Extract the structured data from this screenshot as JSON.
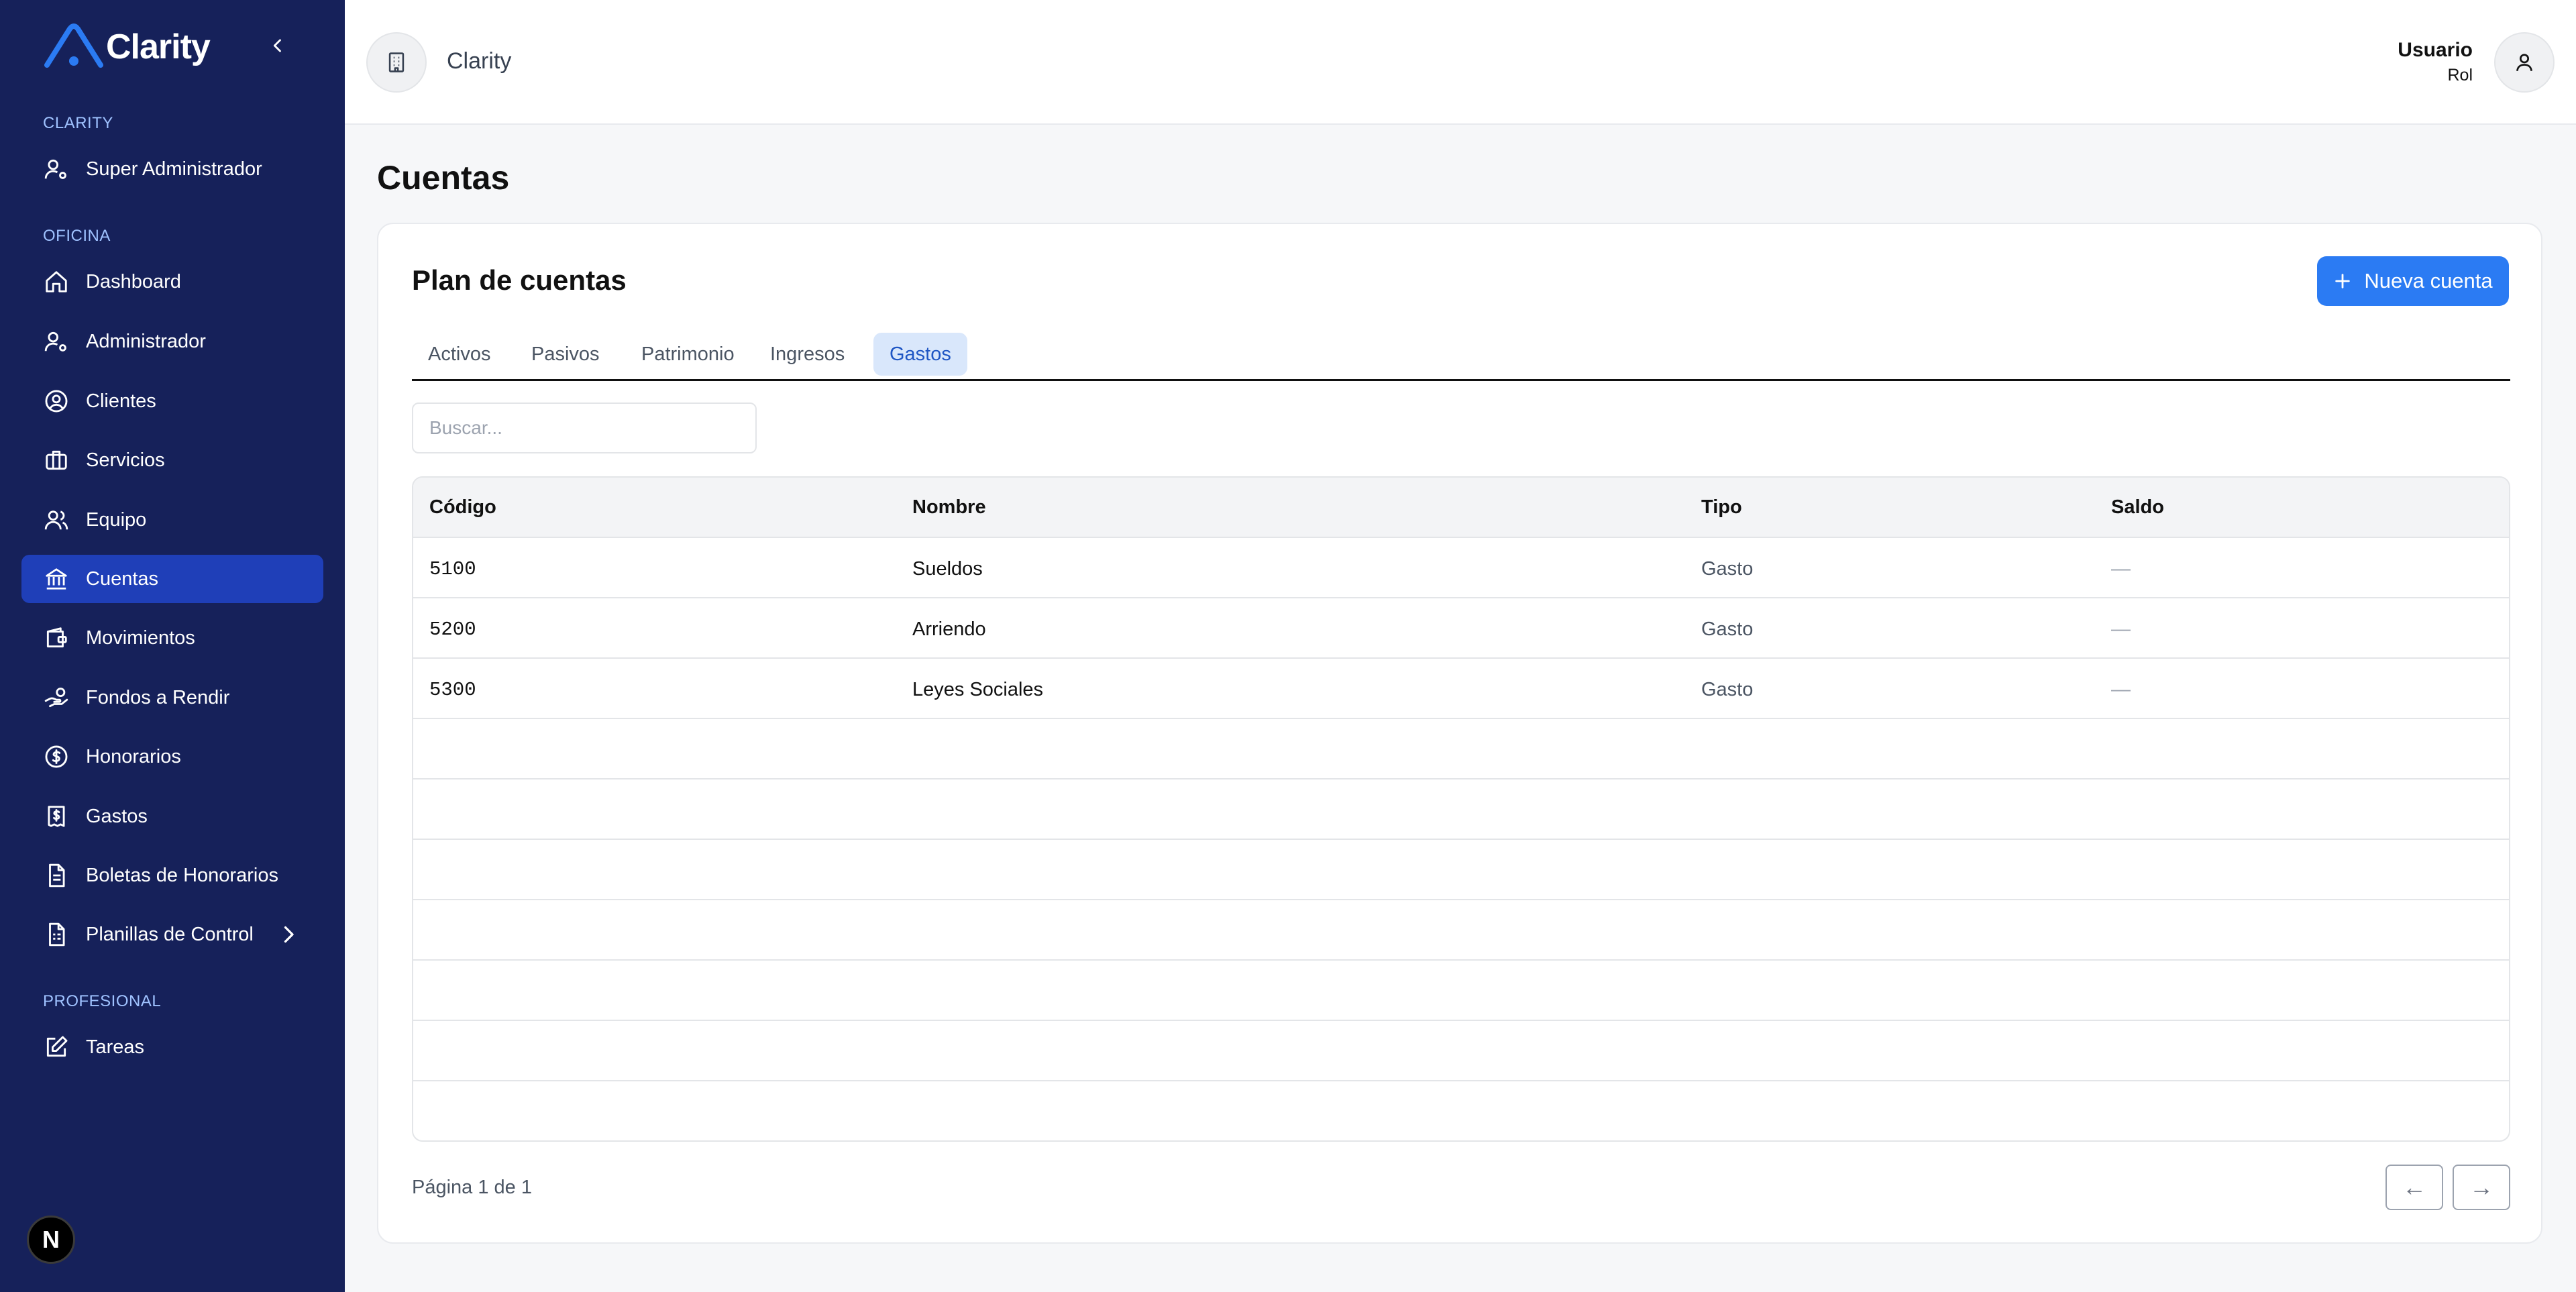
{
  "brand": {
    "name": "Clarity",
    "accent": "#2b7bf3"
  },
  "sidebar": {
    "sections": [
      {
        "label": "CLARITY",
        "items": [
          {
            "label": "Super Administrador",
            "icon": "user-gear-icon"
          }
        ]
      },
      {
        "label": "OFICINA",
        "items": [
          {
            "label": "Dashboard",
            "icon": "home-icon"
          },
          {
            "label": "Administrador",
            "icon": "user-gear-icon"
          },
          {
            "label": "Clientes",
            "icon": "user-circle-icon"
          },
          {
            "label": "Servicios",
            "icon": "briefcase-icon"
          },
          {
            "label": "Equipo",
            "icon": "users-icon"
          },
          {
            "label": "Cuentas",
            "icon": "bank-icon",
            "active": true
          },
          {
            "label": "Movimientos",
            "icon": "wallet-icon"
          },
          {
            "label": "Fondos a Rendir",
            "icon": "hand-coins-icon"
          },
          {
            "label": "Honorarios",
            "icon": "dollar-circle-icon"
          },
          {
            "label": "Gastos",
            "icon": "receipt-dollar-icon"
          },
          {
            "label": "Boletas de Honorarios",
            "icon": "document-icon"
          },
          {
            "label": "Planillas de Control",
            "icon": "spreadsheet-icon"
          }
        ]
      },
      {
        "label": "PROFESIONAL",
        "items": [
          {
            "label": "Tareas",
            "icon": "pencil-square-icon"
          }
        ]
      }
    ],
    "badge": "N"
  },
  "header": {
    "org_name": "Clarity",
    "user_name": "Usuario",
    "user_role": "Rol"
  },
  "page": {
    "title": "Cuentas"
  },
  "card": {
    "title": "Plan de cuentas",
    "new_button": "Nueva cuenta",
    "tabs": [
      "Activos",
      "Pasivos",
      "Patrimonio",
      "Ingresos",
      "Gastos"
    ],
    "active_tab": "Gastos",
    "search_placeholder": "Buscar..."
  },
  "table": {
    "columns": [
      "Código",
      "Nombre",
      "Tipo",
      "Saldo"
    ],
    "rows": [
      {
        "codigo": "5100",
        "nombre": "Sueldos",
        "tipo": "Gasto",
        "saldo": "—"
      },
      {
        "codigo": "5200",
        "nombre": "Arriendo",
        "tipo": "Gasto",
        "saldo": "—"
      },
      {
        "codigo": "5300",
        "nombre": "Leyes Sociales",
        "tipo": "Gasto",
        "saldo": "—"
      }
    ]
  },
  "pagination": {
    "text": "Página 1 de 1",
    "prev": "←",
    "next": "→"
  }
}
